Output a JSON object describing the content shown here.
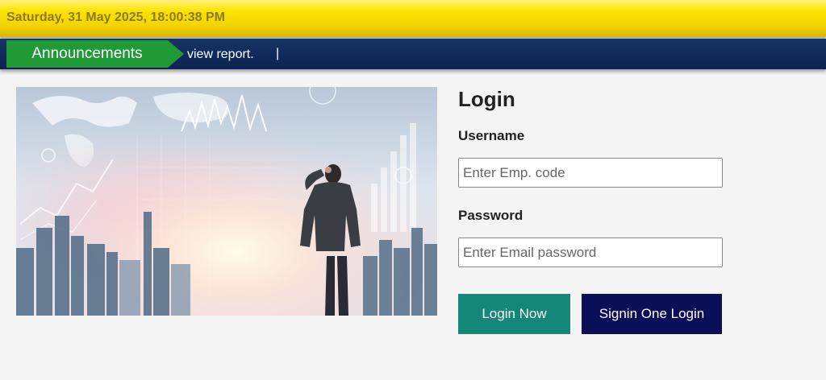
{
  "header": {
    "datetime": "Saturday, 31 May 2025, 18:00:38 PM"
  },
  "announcements": {
    "label": "Announcements",
    "ticker_text": "view report.",
    "separator": "|"
  },
  "hero": {
    "alt": "Businessman looking at city skyline with charts"
  },
  "login": {
    "title": "Login",
    "username_label": "Username",
    "username_placeholder": "Enter Emp. code",
    "username_value": "",
    "password_label": "Password",
    "password_placeholder": "Enter Email password",
    "password_value": "",
    "login_button": "Login Now",
    "signin_button": "Signin One Login"
  },
  "colors": {
    "date_bar": "#f2d400",
    "announcement_bar": "#0f2a5a",
    "announcement_label": "#1f9a36",
    "login_button": "#138778",
    "signin_button": "#0a0f57"
  }
}
